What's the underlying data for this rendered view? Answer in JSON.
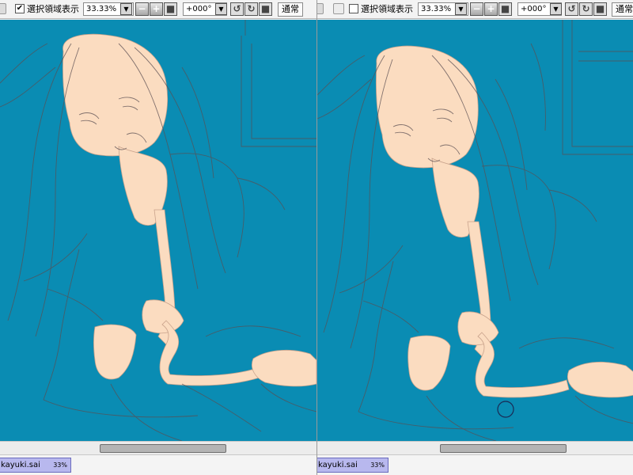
{
  "panes": [
    {
      "id": "left",
      "toolbar": {
        "selection_checked": true,
        "selection_mark": "✔",
        "selection_label": "選択領域表示",
        "zoom": "33.33%",
        "angle": "+000°",
        "blend_mode": "通常"
      },
      "status": {
        "doc_name": "kayuki.sai",
        "zoom": "33%"
      },
      "brush_cursor_visible": false
    },
    {
      "id": "right",
      "toolbar": {
        "selection_checked": false,
        "selection_mark": "",
        "selection_label": "選択領域表示",
        "zoom": "33.33%",
        "angle": "+000°",
        "blend_mode": "通常"
      },
      "status": {
        "doc_name": "kayuki.sai",
        "zoom": "33%"
      },
      "brush_cursor_visible": true
    }
  ],
  "icons": {
    "zoom_dropdown": "chevron-down-icon",
    "zoom_out": "minus-icon",
    "zoom_in": "plus-icon",
    "zoom_reset": "square-icon",
    "rotate_dropdown": "chevron-down-icon",
    "rotate_ccw": "rotate-ccw-icon",
    "rotate_cw": "rotate-cw-icon",
    "rotate_reset": "square-icon"
  },
  "colors": {
    "canvas_bg": "#0a8cb3",
    "skin_fill": "#fbdcc0",
    "line_art": "#5a4e52",
    "doc_tab": "#b8b8ee"
  }
}
